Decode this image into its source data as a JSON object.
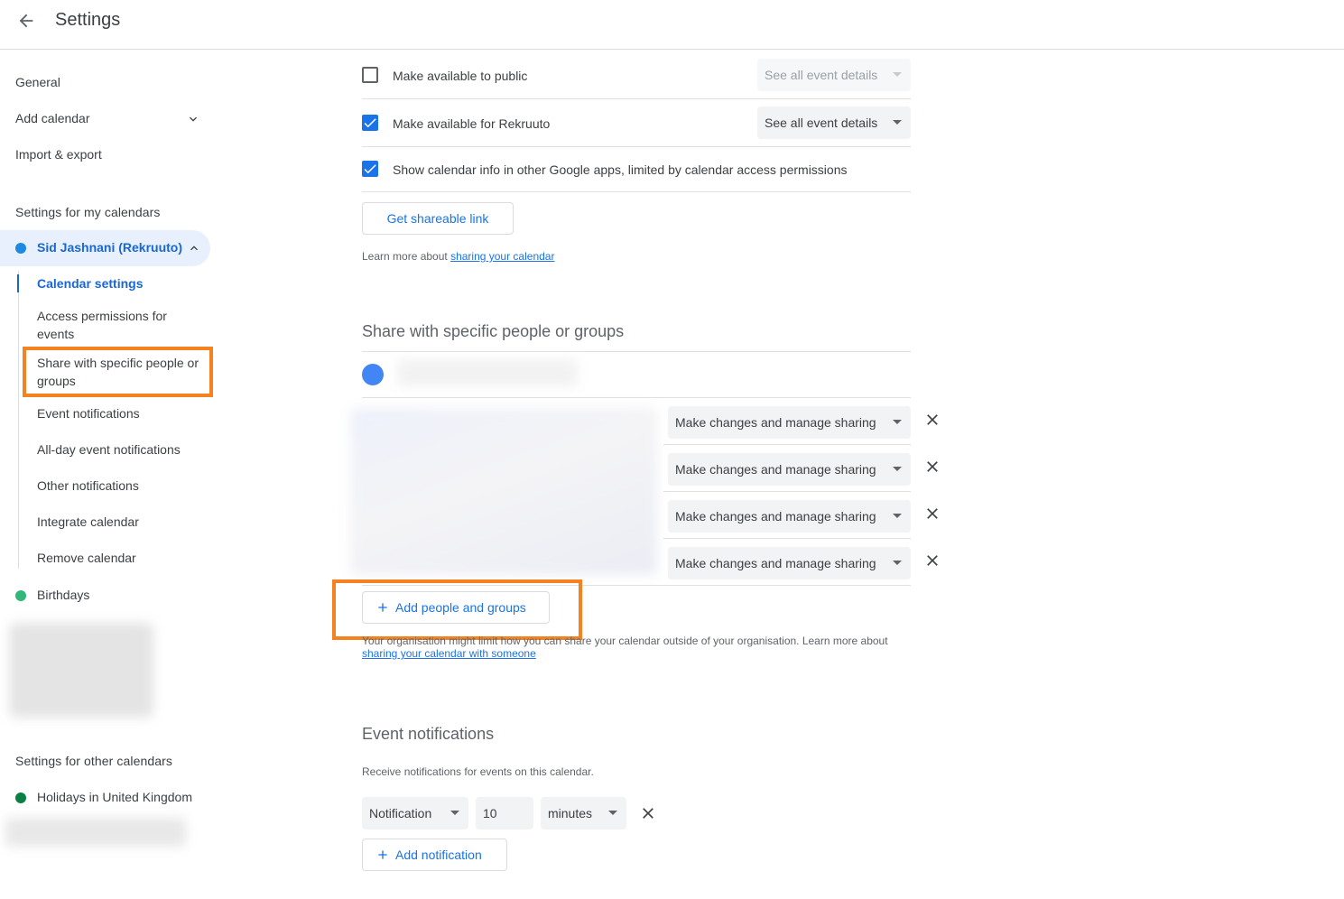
{
  "header": {
    "title": "Settings"
  },
  "sidebar": {
    "general": "General",
    "add_calendar": "Add calendar",
    "import_export": "Import & export",
    "my_calendars_heading": "Settings for my calendars",
    "active_calendar": "Sid Jashnani (Rekruuto)",
    "sub_items": [
      "Calendar settings",
      "Access permissions for events",
      "Share with specific people or groups",
      "Event notifications",
      "All-day event notifications",
      "Other notifications",
      "Integrate calendar",
      "Remove calendar"
    ],
    "birthdays": "Birthdays",
    "other_calendars_heading": "Settings for other calendars",
    "holidays": "Holidays in United Kingdom"
  },
  "access": {
    "public_label": "Make available to public",
    "public_select": "See all event details",
    "org_label": "Make available for Rekruuto",
    "org_select": "See all event details",
    "google_apps_label": "Show calendar info in other Google apps, limited by calendar access permissions",
    "shareable_link_button": "Get shareable link",
    "learn_more_prefix": "Learn more about ",
    "learn_more_link": "sharing your calendar"
  },
  "share": {
    "title": "Share with specific people or groups",
    "permissions": [
      "Make changes and manage sharing",
      "Make changes and manage sharing",
      "Make changes and manage sharing",
      "Make changes and manage sharing"
    ],
    "add_button": "Add people and groups",
    "note": "Your organisation might limit how you can share your calendar outside of your organisation. Learn more about",
    "note_link": "sharing your calendar with someone"
  },
  "notifications": {
    "title": "Event notifications",
    "description": "Receive notifications for events on this calendar.",
    "type": "Notification",
    "amount": "10",
    "unit": "minutes",
    "add_button": "Add notification"
  },
  "colors": {
    "accent": "#1a73e8",
    "active_text": "#1967d2",
    "highlight": "#f58220",
    "dot_primary": "#1e88e5",
    "dot_birthdays": "#33b679",
    "dot_holidays": "#0b8043"
  }
}
